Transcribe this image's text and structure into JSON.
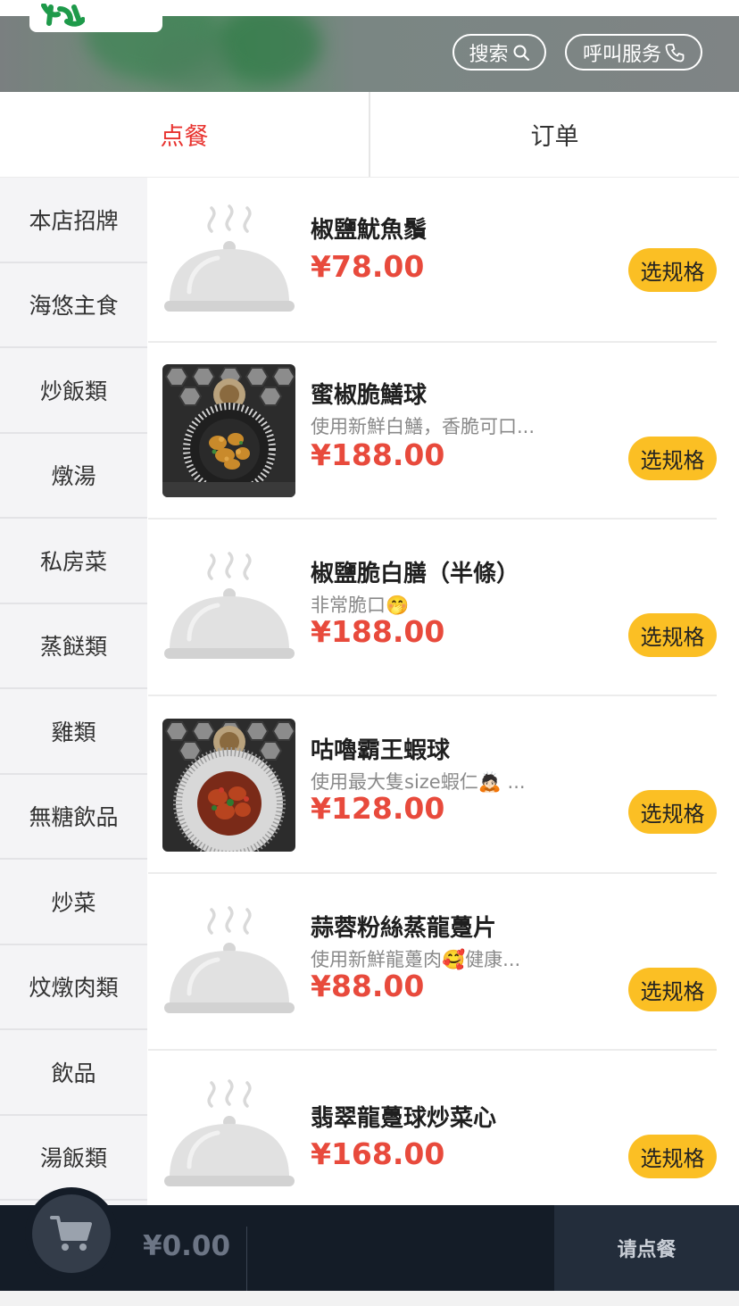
{
  "header": {
    "search_label": "搜索",
    "service_label": "呼叫服务"
  },
  "tabs": [
    {
      "label": "点餐",
      "active": true
    },
    {
      "label": "订单",
      "active": false
    }
  ],
  "colors": {
    "accent_red": "#e8322e",
    "price_red": "#e84a3c",
    "button_yellow": "#fbbf24",
    "bottom_bar": "#141c27"
  },
  "sidebar": {
    "items": [
      {
        "label": "本店招牌"
      },
      {
        "label": "海悠主食"
      },
      {
        "label": "炒飯類"
      },
      {
        "label": "燉湯"
      },
      {
        "label": "私房菜"
      },
      {
        "label": "蒸餸類"
      },
      {
        "label": "雞類"
      },
      {
        "label": "無糖飲品"
      },
      {
        "label": "炒菜"
      },
      {
        "label": "炆燉肉類"
      },
      {
        "label": "飲品"
      },
      {
        "label": "湯飯類"
      }
    ]
  },
  "dishes": [
    {
      "name": "椒鹽魷魚鬚",
      "desc": "",
      "price": "¥78.00",
      "button": "选规格",
      "image": "placeholder-cloche-icon"
    },
    {
      "name": "蜜椒脆鱔球",
      "desc": "使用新鮮白鱔，香脆可口...",
      "price": "¥188.00",
      "button": "选规格",
      "image": "dish-photo"
    },
    {
      "name": "椒鹽脆白膳（半條）",
      "desc": "非常脆口🤭",
      "price": "¥188.00",
      "button": "选规格",
      "image": "placeholder-cloche-icon"
    },
    {
      "name": "咕嚕霸王蝦球",
      "desc": "使用最大隻size蝦仁🙇🏻 ...",
      "price": "¥128.00",
      "button": "选规格",
      "image": "dish-photo"
    },
    {
      "name": "蒜蓉粉絲蒸龍躉片",
      "desc": "使用新鮮龍躉肉🥰健康...",
      "price": "¥88.00",
      "button": "选规格",
      "image": "placeholder-cloche-icon"
    },
    {
      "name": "翡翠龍躉球炒菜心",
      "desc": "",
      "price": "¥168.00",
      "button": "选规格",
      "image": "placeholder-cloche-icon"
    }
  ],
  "cart": {
    "total": "¥0.00",
    "checkout_label": "请点餐",
    "icon": "shopping-cart-icon"
  }
}
